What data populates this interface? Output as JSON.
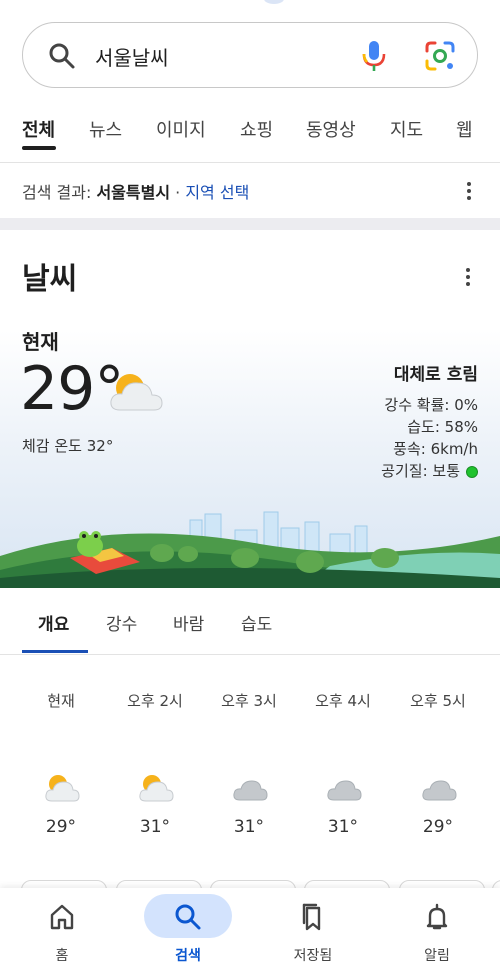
{
  "search": {
    "query": "서울날씨"
  },
  "tabs": [
    {
      "label": "전체"
    },
    {
      "label": "뉴스"
    },
    {
      "label": "이미지"
    },
    {
      "label": "쇼핑"
    },
    {
      "label": "동영상"
    },
    {
      "label": "지도"
    },
    {
      "label": "웹"
    }
  ],
  "results_location": {
    "prefix": "검색 결과: ",
    "location": "서울특별시",
    "separator": " · ",
    "link": "지역 선택"
  },
  "weather": {
    "title": "날씨",
    "now_label": "현재",
    "temperature": "29°",
    "feels_like": "체감 온도 32°",
    "condition": "대체로 흐림",
    "precip": "강수 확률: 0%",
    "humidity": "습도: 58%",
    "wind": "풍속: 6km/h",
    "air_quality": "공기질: 보통",
    "air_quality_color": "#1fc22e"
  },
  "sub_tabs": [
    {
      "label": "개요"
    },
    {
      "label": "강수"
    },
    {
      "label": "바람"
    },
    {
      "label": "습도"
    }
  ],
  "hourly": [
    {
      "time": "현재",
      "icon": "partly-cloudy-icon",
      "temp": "29°"
    },
    {
      "time": "오후 2시",
      "icon": "partly-cloudy-icon",
      "temp": "31°"
    },
    {
      "time": "오후 3시",
      "icon": "cloudy-icon",
      "temp": "31°"
    },
    {
      "time": "오후 4시",
      "icon": "cloudy-icon",
      "temp": "31°"
    },
    {
      "time": "오후 5시",
      "icon": "cloudy-icon",
      "temp": "29°"
    }
  ],
  "bottom_nav": [
    {
      "label": "홈",
      "icon": "home-icon"
    },
    {
      "label": "검색",
      "icon": "search-icon"
    },
    {
      "label": "저장됨",
      "icon": "bookmarks-icon"
    },
    {
      "label": "알림",
      "icon": "bell-icon"
    }
  ],
  "colors": {
    "accent": "#0b57d0",
    "link": "#1a4fb5",
    "nav_active_bg": "#d3e3fd"
  }
}
